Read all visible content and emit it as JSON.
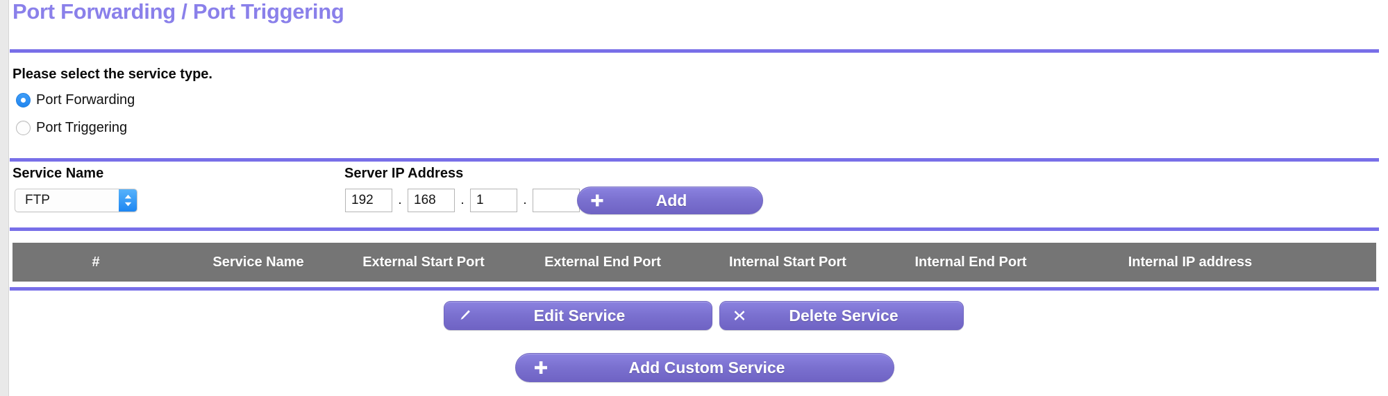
{
  "page": {
    "title": "Port Forwarding / Port Triggering"
  },
  "service_type": {
    "heading": "Please select the service type.",
    "options": [
      {
        "label": "Port Forwarding",
        "selected": true
      },
      {
        "label": "Port Triggering",
        "selected": false
      }
    ]
  },
  "service_form": {
    "service_name_label": "Service Name",
    "service_name_value": "FTP",
    "service_name_options": [
      "FTP"
    ],
    "server_ip_label": "Server IP Address",
    "ip_octets": [
      "192",
      "168",
      "1",
      ""
    ],
    "ip_separator": ".",
    "add_button": {
      "label": "Add",
      "icon": "plus-icon"
    }
  },
  "table": {
    "columns": [
      "#",
      "Service Name",
      "External Start Port",
      "External End Port",
      "Internal Start Port",
      "Internal End Port",
      "Internal IP address"
    ],
    "rows": []
  },
  "actions": {
    "edit": {
      "label": "Edit Service",
      "icon": "pencil-icon"
    },
    "delete": {
      "label": "Delete Service",
      "icon": "x-icon"
    },
    "add_custom": {
      "label": "Add Custom Service",
      "icon": "plus-icon"
    }
  },
  "colors": {
    "title": "#8a80ea",
    "rule": "#786fe8",
    "button": "#7a70cf",
    "table_header": "#757575",
    "radio_selected": "#2f93f5"
  }
}
